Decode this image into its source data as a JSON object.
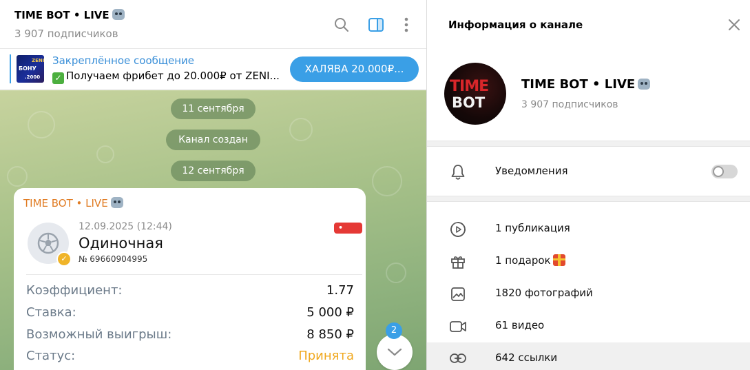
{
  "chat": {
    "title": "TIME BOT • LIVE",
    "subscribers": "3 907 подписчиков",
    "pinned": {
      "title": "Закреплённое сообщение",
      "text": "Получаем фрибет до 20.000₽ от ZENI...",
      "button": "ХАЛЯВА 20.000₽...",
      "thumb_text_top": "ZENI",
      "thumb_text_mid": "БОНУ",
      "thumb_text_bot": ".2000"
    },
    "date_pills": [
      "11 сентября",
      "Канал создан",
      "12 сентября"
    ],
    "message": {
      "author": "TIME BOT • LIVE",
      "bet": {
        "datetime": "12.09.2025 (12:44)",
        "title": "Одиночная",
        "number": "№ 69660904995",
        "live_badge": "• Live"
      },
      "rows": [
        {
          "key": "Коэффициент:",
          "value": "1.77"
        },
        {
          "key": "Ставка:",
          "value": "5 000 ₽"
        },
        {
          "key": "Возможный выигрыш:",
          "value": "8 850 ₽"
        },
        {
          "key": "Статус:",
          "value": "Принята"
        }
      ]
    },
    "unread_count": "2"
  },
  "info_panel": {
    "title": "Информация о канале",
    "channel_name": "TIME BOT • LIVE",
    "channel_subscribers": "3 907 подписчиков",
    "avatar_text_top": "TIME",
    "avatar_text_bottom": "BOT",
    "notifications_label": "Уведомления",
    "notifications_enabled": false,
    "media": [
      {
        "icon": "play-circle-icon",
        "label": "1 публикация"
      },
      {
        "icon": "gift-icon",
        "label": "1 подарок"
      },
      {
        "icon": "photo-icon",
        "label": "1820 фотографий"
      },
      {
        "icon": "video-icon",
        "label": "61 видео"
      },
      {
        "icon": "link-icon",
        "label": "642 ссылки"
      }
    ]
  },
  "colors": {
    "accent": "#3a9fe6",
    "author": "#e07b22",
    "status_accepted": "#f0a81e",
    "live": "#e53935"
  }
}
